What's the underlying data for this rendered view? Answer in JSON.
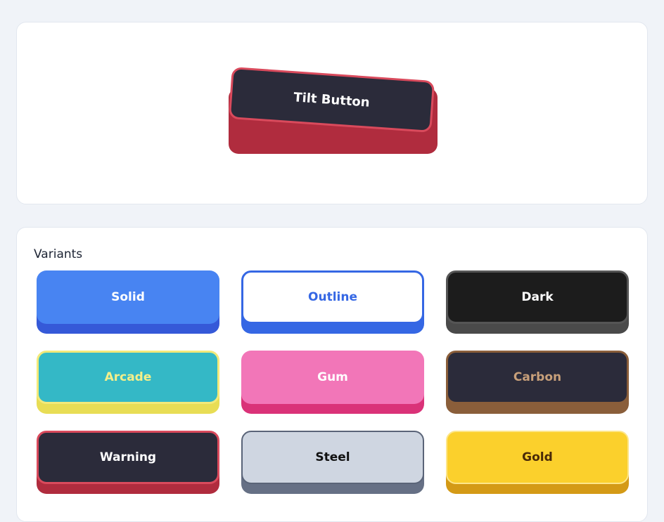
{
  "hero": {
    "tilt_button_label": "Tilt Button"
  },
  "variants": {
    "title": "Variants",
    "items": [
      {
        "label": "Solid"
      },
      {
        "label": "Outline"
      },
      {
        "label": "Dark"
      },
      {
        "label": "Arcade"
      },
      {
        "label": "Gum"
      },
      {
        "label": "Carbon"
      },
      {
        "label": "Warning"
      },
      {
        "label": "Steel"
      },
      {
        "label": "Gold"
      }
    ]
  },
  "colors": {
    "page_bg": "#f0f3f8",
    "solid": "#4884f2",
    "outline_border": "#3567e4",
    "dark": "#1c1c1c",
    "arcade": "#34b8c6",
    "arcade_base": "#e8dd55",
    "gum": "#f276b8",
    "carbon_base": "#8a5e3a",
    "warning_border": "#d94a5c",
    "steel": "#cfd6e1",
    "gold": "#fbd02c"
  }
}
